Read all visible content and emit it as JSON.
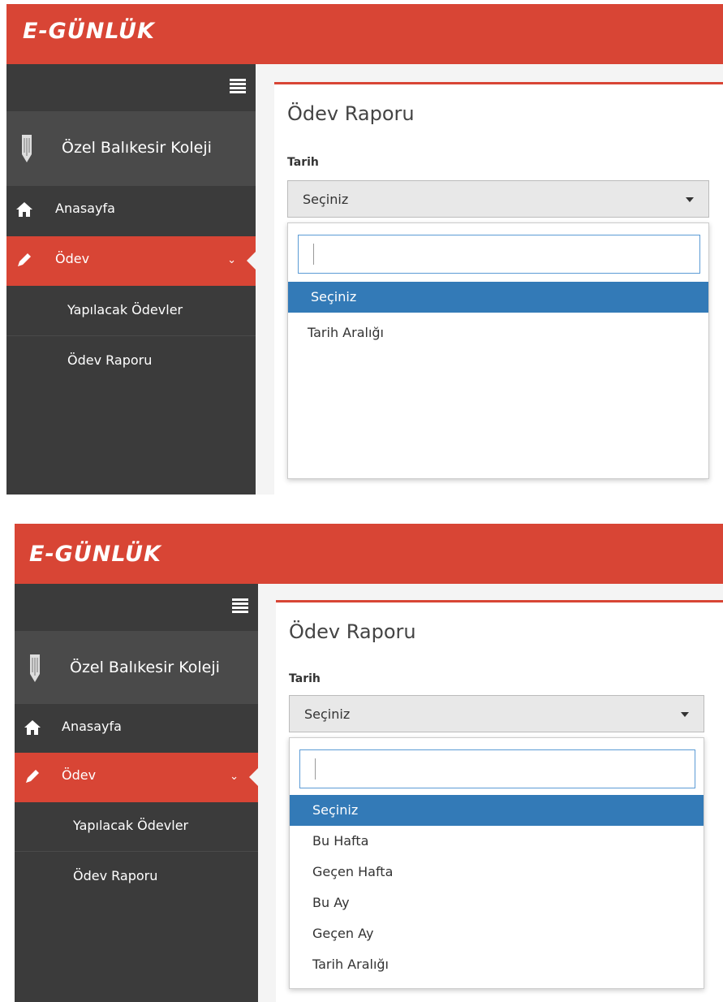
{
  "brand": "E-GÜNLÜK",
  "colors": {
    "accent": "#d84535",
    "sidebar": "#3b3b3b",
    "selected": "#337ab7"
  },
  "sidebar": {
    "school_name": "Özel Balıkesir Koleji",
    "items": [
      {
        "label": "Anasayfa",
        "icon": "home-icon"
      },
      {
        "label": "Ödev",
        "icon": "pencil-icon"
      }
    ],
    "subitems": [
      {
        "label": "Yapılacak Ödevler"
      },
      {
        "label": "Ödev Raporu"
      }
    ]
  },
  "screens": [
    {
      "title": "Ödev Raporu",
      "field_label": "Tarih",
      "select_value": "Seçiniz",
      "options": [
        "Seçiniz",
        "Tarih Aralığı"
      ],
      "selected_option": "Seçiniz"
    },
    {
      "title": "Ödev Raporu",
      "field_label": "Tarih",
      "select_value": "Seçiniz",
      "options": [
        "Seçiniz",
        "Bu Hafta",
        "Geçen Hafta",
        "Bu Ay",
        "Geçen Ay",
        "Tarih Aralığı"
      ],
      "selected_option": "Seçiniz"
    }
  ]
}
